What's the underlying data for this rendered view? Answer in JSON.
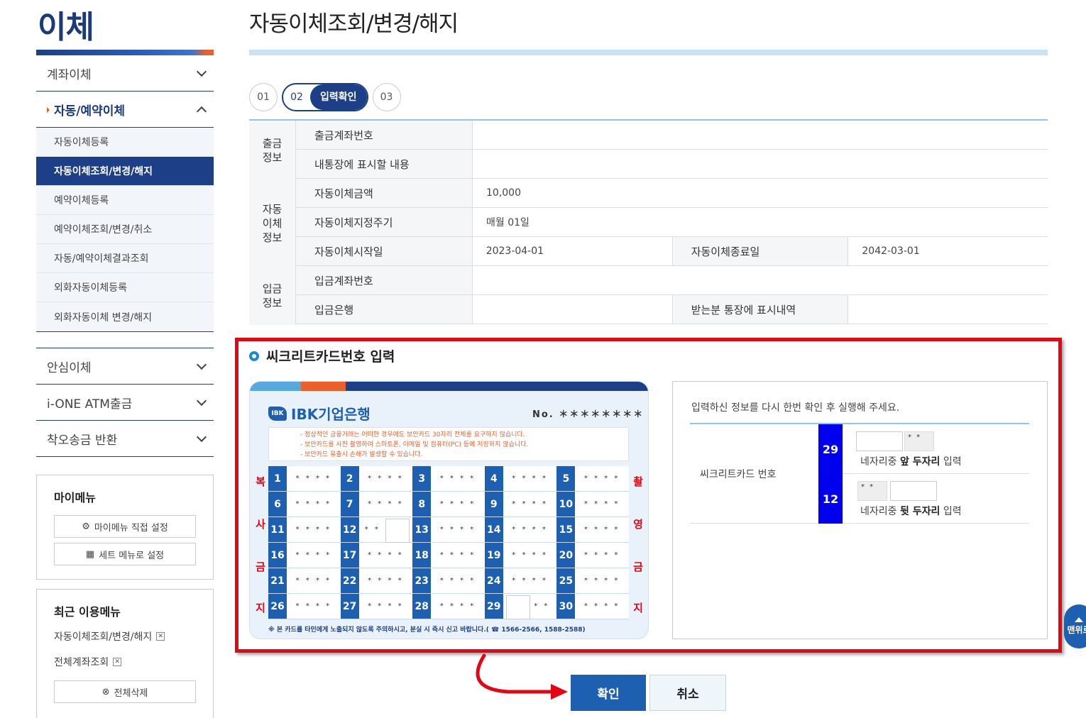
{
  "sidebar": {
    "title": "이체",
    "menu_top": [
      {
        "label": "계좌이체"
      }
    ],
    "active_menu": {
      "label": "자동/예약이체"
    },
    "sub_items": [
      {
        "label": "자동이체등록"
      },
      {
        "label": "자동이체조회/변경/해지"
      },
      {
        "label": "예약이체등록"
      },
      {
        "label": "예약이체조회/변경/취소"
      },
      {
        "label": "자동/예약이체결과조회"
      },
      {
        "label": "외화자동이체등록"
      },
      {
        "label": "외화자동이체 변경/해지"
      }
    ],
    "menu_bottom": [
      {
        "label": "안심이체"
      },
      {
        "label": "i-ONE ATM출금"
      },
      {
        "label": "착오송금 반환"
      }
    ],
    "my_menu": {
      "title": "마이메뉴",
      "btn_direct": "마이메뉴 직접 설정",
      "btn_set": "세트 메뉴로 설정"
    },
    "recent": {
      "title": "최근 이용메뉴",
      "items": [
        "자동이체조회/변경/해지",
        "전체계좌조회"
      ],
      "delete_all": "전체삭제"
    }
  },
  "main": {
    "page_title": "자동이체조회/변경/해지",
    "steps": {
      "s1": "01",
      "s2": "02",
      "s2_label": "입력확인",
      "s3": "03"
    },
    "info": {
      "grp_out": "출금\n정보",
      "grp_auto": "자동\n이체\n정보",
      "grp_in": "입금\n정보",
      "out_account": "출금계좌번호",
      "passbook_memo": "내통장에 표시할 내용",
      "amount_label": "자동이체금액",
      "amount_value": "10,000",
      "cycle_label": "자동이체지정주기",
      "cycle_value": "매월 01일",
      "start_label": "자동이체시작일",
      "start_value": "2023-04-01",
      "end_label": "자동이체종료일",
      "end_value": "2042-03-01",
      "in_account": "입금계좌번호",
      "in_bank": "입금은행",
      "recv_memo": "받는분 통장에 표시내역"
    },
    "secret": {
      "title": "씨크리트카드번호 입력",
      "card": {
        "brand": "IBK기업은행",
        "logo_mark": "IBK",
        "no_label": "No.",
        "no_value": "＊＊＊＊＊＊＊＊",
        "warn1": "- 정상적인 금융거래는 어떠한 경우에도 보안카드 30자리 전체를 요구하지 않습니다.",
        "warn2": "- 보안카드를 사진 촬영하여 스마트폰, 이메일 및 컴퓨터(PC) 등에 저장하지 않습니다.",
        "warn3": "- 보안카드 유출시 손해가 발생할 수 있습니다.",
        "left_side": [
          "복",
          "사",
          "금",
          "지"
        ],
        "right_side": [
          "촬",
          "영",
          "금",
          "지"
        ],
        "mask": "* * * *",
        "mask2": "* *",
        "footer": "※ 본 카드를 타인에게 노출되지 않도록 주의하시고, 분실 시 즉시 신고 바랍니다.( ☎ 1566-2566, 1588-2588)"
      },
      "confirm_msg": "입력하신 정보를 다시 한번 확인 후 실행해 주세요.",
      "card_label": "씨크리트카드 번호",
      "front_no": "29",
      "back_no": "12",
      "mask_value": "* *",
      "front_hint_pre": "네자리중 ",
      "front_hint_b": "앞 두자리",
      "front_hint_post": " 입력",
      "back_hint_pre": "네자리중 ",
      "back_hint_b": "뒷 두자리",
      "back_hint_post": " 입력"
    },
    "buttons": {
      "ok": "확인",
      "cancel": "취소"
    },
    "top_btn": "맨위로"
  }
}
